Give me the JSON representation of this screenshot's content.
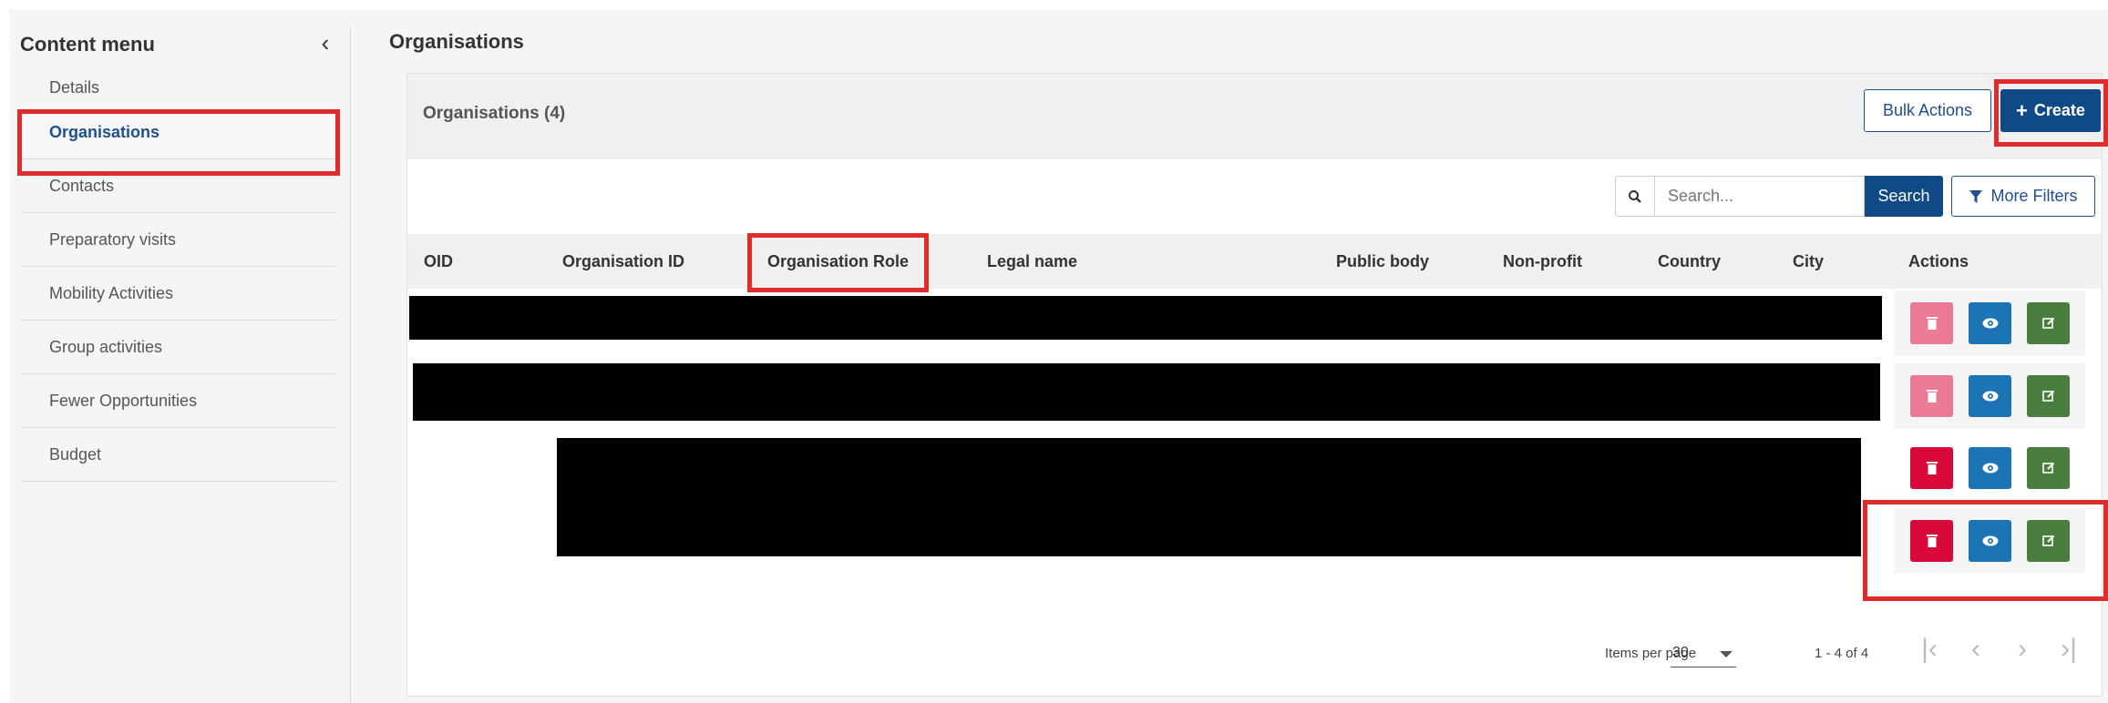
{
  "sidebar": {
    "title": "Content menu",
    "collapse_icon": "chevron-left-icon",
    "items": [
      {
        "label": "Details"
      },
      {
        "label": "Organisations",
        "active": true
      },
      {
        "label": "Contacts"
      },
      {
        "label": "Preparatory visits"
      },
      {
        "label": "Mobility Activities"
      },
      {
        "label": "Group activities"
      },
      {
        "label": "Fewer Opportunities"
      },
      {
        "label": "Budget"
      }
    ]
  },
  "page": {
    "title": "Organisations"
  },
  "panel": {
    "title": "Organisations (4)",
    "bulk_actions_label": "Bulk Actions",
    "create_label": "Create",
    "search_placeholder": "Search...",
    "search_label": "Search",
    "more_filters_label": "More Filters"
  },
  "table": {
    "columns": [
      "OID",
      "Organisation ID",
      "Organisation Role",
      "Legal name",
      "Public body",
      "Non-profit",
      "Country",
      "City",
      "Actions"
    ],
    "rows": [
      {
        "delete_enabled": false
      },
      {
        "delete_enabled": false
      },
      {
        "delete_enabled": true
      },
      {
        "delete_enabled": true
      }
    ]
  },
  "pagination": {
    "items_per_page_label": "Items per page",
    "items_per_page_value": "30",
    "range_text": "1 - 4 of 4"
  },
  "colors": {
    "primary": "#0f4a87",
    "delete": "#d9083a",
    "delete_disabled": "#eb7a97",
    "view": "#1c74b5",
    "edit": "#4a7e3f",
    "highlight": "#e02b2b"
  }
}
